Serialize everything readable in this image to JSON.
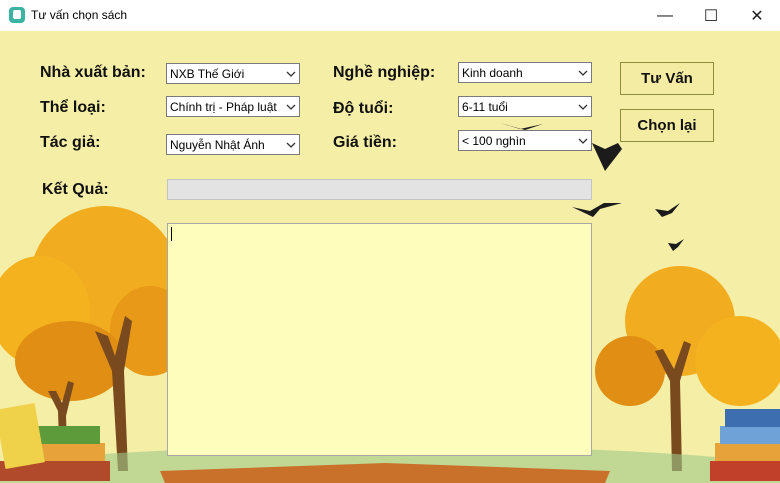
{
  "window": {
    "title": "Tư vấn chọn sách",
    "minimize_glyph": "—",
    "maximize_glyph": "☐",
    "close_glyph": "✕"
  },
  "form": {
    "publisher": {
      "label": "Nhà xuất bản:",
      "value": "NXB Thế Giới"
    },
    "genre": {
      "label": "Thể loại:",
      "value": "Chính trị - Pháp luật"
    },
    "author": {
      "label": "Tác giả:",
      "value": "Nguyễn Nhật Ánh"
    },
    "occupation": {
      "label": "Nghề nghiệp:",
      "value": "Kinh doanh"
    },
    "age": {
      "label": "Độ tuổi:",
      "value": "6-11 tuổi"
    },
    "price": {
      "label": "Giá tiền:",
      "value": "< 100 nghìn"
    }
  },
  "buttons": {
    "advise": "Tư Vấn",
    "reset": "Chọn lại"
  },
  "result": {
    "label": "Kết Quả:",
    "value": "",
    "output_text": ""
  },
  "icons": {
    "app": "book-app-icon",
    "dropdown": "chevron-down-icon"
  },
  "colors": {
    "background": "#f4eea6",
    "output_bg": "#fefdbc",
    "tree_orange": "#f0a91e",
    "tree_trunk": "#7a4a1f"
  }
}
